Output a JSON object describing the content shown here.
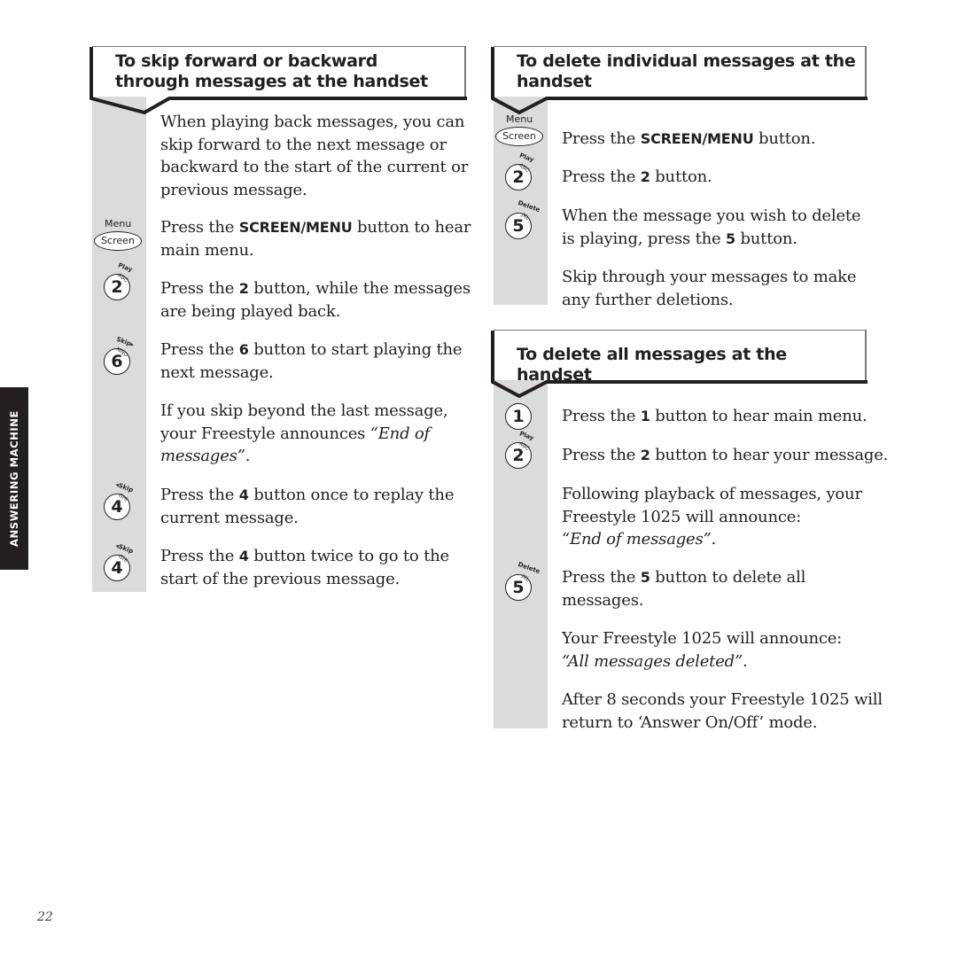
{
  "side_tab": {
    "label": "ANSWERING MACHINE"
  },
  "page_number": "22",
  "sections": [
    {
      "title_line1": "To skip forward or backward",
      "title_line2": "through messages at the handset",
      "steps": [
        {
          "text": [
            "When playing back messages, you can",
            "skip forward to the next message or",
            "backward to the start of the current or",
            "previous message."
          ]
        },
        {
          "icon": "screen-menu-key-icon",
          "pre": "Press the ",
          "bold": "SCREEN/MENU",
          "post": " button to hear",
          "line2": "main menu."
        },
        {
          "icon": "key-2-play-icon",
          "pre": "Press the ",
          "bold": "2",
          "post": " button, while the messages",
          "line2": "are being played back."
        },
        {
          "icon": "key-6-skip-forward-icon",
          "pre": "Press the ",
          "bold": "6",
          "post": " button to start playing the",
          "line2": "next message."
        },
        {
          "line1": "If you skip beyond the last message,",
          "line2_pre": "your Freestyle announces ",
          "line2_italic": "“End of",
          "line3_italic": "messages”",
          "line3_post": "."
        },
        {
          "icon": "key-4-skip-back-icon",
          "pre": "Press the ",
          "bold": "4",
          "post": " button once to replay the",
          "line2": "current message."
        },
        {
          "icon": "key-4-skip-back-icon",
          "pre": "Press the ",
          "bold": "4",
          "post": " button twice to go to the",
          "line2": "start of the previous message."
        }
      ]
    },
    {
      "title_line1": "To delete individual messages at the",
      "title_line2": "handset",
      "steps": [
        {
          "icon": "screen-menu-key-icon",
          "pre": "Press the ",
          "bold": "SCREEN/MENU",
          "post": " button."
        },
        {
          "icon": "key-2-play-icon",
          "pre": "Press the ",
          "bold": "2",
          "post": " button."
        },
        {
          "icon": "key-5-delete-icon",
          "line1": "When the message you wish to delete",
          "pre": "is playing, press the ",
          "bold": "5",
          "post": " button."
        },
        {
          "line1": "Skip through your messages to make",
          "line2": "any further deletions."
        }
      ]
    },
    {
      "title_line1": "To delete all messages at the handset",
      "steps": [
        {
          "icon": "key-1-icon",
          "pre": "Press the ",
          "bold": "1",
          "post": " button to hear main menu."
        },
        {
          "icon": "key-2-play-icon",
          "pre": "Press the ",
          "bold": "2",
          "post": " button to hear your message."
        },
        {
          "line1": "Following playback of messages, your",
          "line2": "Freestyle 1025 will announce:",
          "line3_italic": "“End of messages”",
          "line3_post": "."
        },
        {
          "icon": "key-5-delete-icon",
          "pre": "Press the ",
          "bold": "5",
          "post": " button to delete all",
          "line2": "messages."
        },
        {
          "line1": "Your Freestyle 1025 will announce:",
          "line2_italic": "“All messages deleted”",
          "line2_post": "."
        },
        {
          "line1": "After 8 seconds your Freestyle 1025 will",
          "line2": "return to ‘Answer On/Off’ mode."
        }
      ]
    }
  ],
  "icons": {
    "menu_label": "Menu",
    "screen_label": "Screen",
    "play_label": "Play",
    "skip_fwd_label": "Skip▸",
    "skip_back_label": "◂Skip",
    "delete_label": "Delete",
    "abc": "ABC",
    "ghi": "GHI",
    "jkl": "JKL",
    "mno": "MNO",
    "n1": "1",
    "n2": "2",
    "n4": "4",
    "n5": "5",
    "n6": "6"
  },
  "colors": {
    "strip_gray": "#dadbdd",
    "ink": "#231f20",
    "tab_bg": "#231f20"
  }
}
